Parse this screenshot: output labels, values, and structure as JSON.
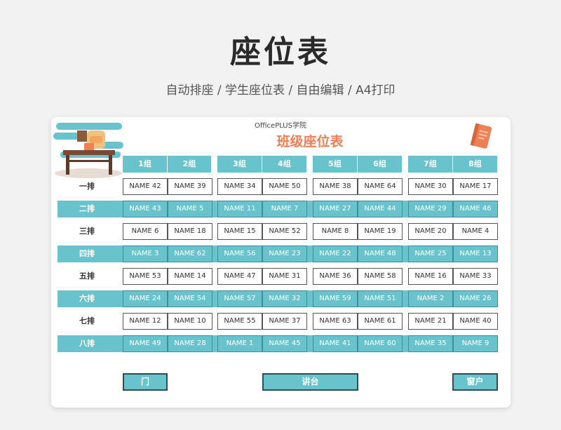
{
  "page": {
    "title": "座位表",
    "subtitle": "自动排座 / 学生座位表 / 自由编辑 / A4打印"
  },
  "sheet": {
    "brand": "OfficePLUS学院",
    "title": "班级座位表",
    "groups": [
      "1组",
      "2组",
      "3组",
      "4组",
      "5组",
      "6组",
      "7组",
      "8组"
    ],
    "rows": [
      {
        "label": "一排",
        "names": [
          "NAME 42",
          "NAME 39",
          "NAME 34",
          "NAME 50",
          "NAME 38",
          "NAME 64",
          "NAME 30",
          "NAME 17"
        ]
      },
      {
        "label": "二排",
        "names": [
          "NAME 43",
          "NAME 5",
          "NAME 11",
          "NAME 7",
          "NAME 27",
          "NAME 44",
          "NAME 29",
          "NAME 46"
        ]
      },
      {
        "label": "三排",
        "names": [
          "NAME 6",
          "NAME 18",
          "NAME 15",
          "NAME 52",
          "NAME 8",
          "NAME 19",
          "NAME 20",
          "NAME 4"
        ]
      },
      {
        "label": "四排",
        "names": [
          "NAME 3",
          "NAME 62",
          "NAME 56",
          "NAME 23",
          "NAME 22",
          "NAME 48",
          "NAME 25",
          "NAME 13"
        ]
      },
      {
        "label": "五排",
        "names": [
          "NAME 53",
          "NAME 14",
          "NAME 47",
          "NAME 31",
          "NAME 36",
          "NAME 58",
          "NAME 16",
          "NAME 33"
        ]
      },
      {
        "label": "六排",
        "names": [
          "NAME 24",
          "NAME 54",
          "NAME 57",
          "NAME 32",
          "NAME 59",
          "NAME 51",
          "NAME 2",
          "NAME 26"
        ]
      },
      {
        "label": "七排",
        "names": [
          "NAME 12",
          "NAME 10",
          "NAME 55",
          "NAME 37",
          "NAME 63",
          "NAME 61",
          "NAME 21",
          "NAME 40"
        ]
      },
      {
        "label": "八排",
        "names": [
          "NAME 49",
          "NAME 28",
          "NAME 1",
          "NAME 45",
          "NAME 41",
          "NAME 60",
          "NAME 35",
          "NAME 9"
        ]
      }
    ],
    "bottom": {
      "door": "门",
      "podium": "讲台",
      "window": "窗户"
    }
  },
  "colors": {
    "accent": "#68c3cd",
    "title_orange": "#ef7f55"
  }
}
